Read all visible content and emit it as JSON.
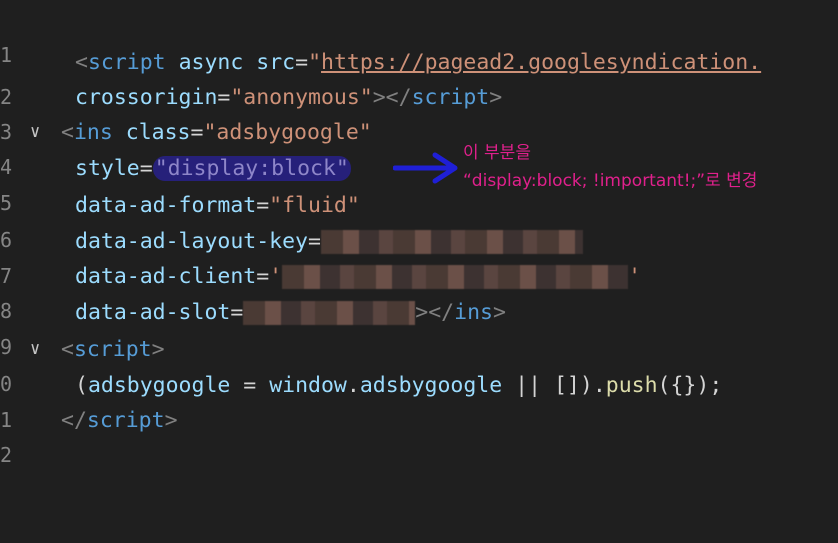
{
  "editor": {
    "line_numbers": [
      "1",
      "2",
      "3",
      "4",
      "5",
      "6",
      "7",
      "8",
      "9",
      "0",
      "1",
      "2"
    ],
    "fold_glyph": "∨",
    "lines": {
      "l2": {
        "open": "<",
        "tag": "script",
        "sp1": " ",
        "a1": "async",
        "sp2": " ",
        "a2": "src",
        "eq": "=",
        "q": "\"",
        "url": "https://pagead2.googlesyndication."
      },
      "l3": {
        "attr": "crossorigin",
        "eq": "=",
        "val": "\"anonymous\"",
        "close": "></",
        "tag": "script",
        "end": ">"
      },
      "l4": {
        "open": "<",
        "tag": "ins",
        "sp": " ",
        "attr": "class",
        "eq": "=",
        "val": "\"adsbygoogle\""
      },
      "l5": {
        "attr": "style",
        "eq": "=",
        "val": "\"display:block\""
      },
      "l6": {
        "attr": "data-ad-format",
        "eq": "=",
        "val": "\"fluid\""
      },
      "l7": {
        "attr": "data-ad-layout-key",
        "eq": "="
      },
      "l8": {
        "attr": "data-ad-client",
        "eq": "=",
        "q": "'"
      },
      "l9": {
        "attr": "data-ad-slot",
        "eq": "=",
        "close": "></",
        "tag": "ins",
        "end": ">"
      },
      "l10": {
        "open": "<",
        "tag": "script",
        "end": ">"
      },
      "l11": {
        "p1": "(",
        "v1": "adsbygoogle",
        "op1": " = ",
        "v2": "window",
        "dot1": ".",
        "v3": "adsbygoogle",
        "op2": " || ",
        "arr": "[]",
        "p2": ").",
        "fn": "push",
        "p3": "({});"
      },
      "l12": {
        "open": "</",
        "tag": "script",
        "end": ">"
      }
    }
  },
  "annotation": {
    "line1": "이 부분을",
    "line2": "“display:block; !important!;”로 변경",
    "color": "#e0208c",
    "arrow_color": "#1f1fd6"
  }
}
